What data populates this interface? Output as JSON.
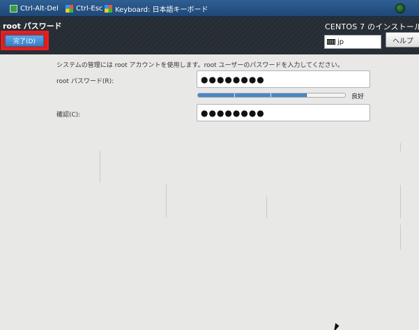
{
  "vnc_bar": {
    "ctrl_alt_del": "Ctrl-Alt-Del",
    "ctrl_esc": "Ctrl-Esc",
    "keyboard": "Keyboard: 日本語キーボード"
  },
  "header": {
    "page_title": "root パスワード",
    "done_label": "完了(D)",
    "install_title": "CENTOS 7 のインストール",
    "keyboard_layout": "jp",
    "help_label": "ヘルプ"
  },
  "form": {
    "description": "システムの管理には root アカウントを使用します。root ユーザーのパスワードを入力してください。",
    "password_label": "root パスワード(R):",
    "password_value": "●●●●●●●●",
    "strength": 0.74,
    "strength_label": "良好",
    "confirm_label": "確認(C):",
    "confirm_value": "●●●●●●●●"
  },
  "colors": {
    "header_bg": "#262c33",
    "accent_blue": "#4a86c9",
    "highlight_red": "#ec1e1e",
    "content_bg": "#e8e8e7"
  },
  "icons": {
    "monitor": "monitor-icon",
    "flag": "windows-flag-icon",
    "keyboard": "keyboard-icon",
    "status": "connection-status-icon"
  }
}
